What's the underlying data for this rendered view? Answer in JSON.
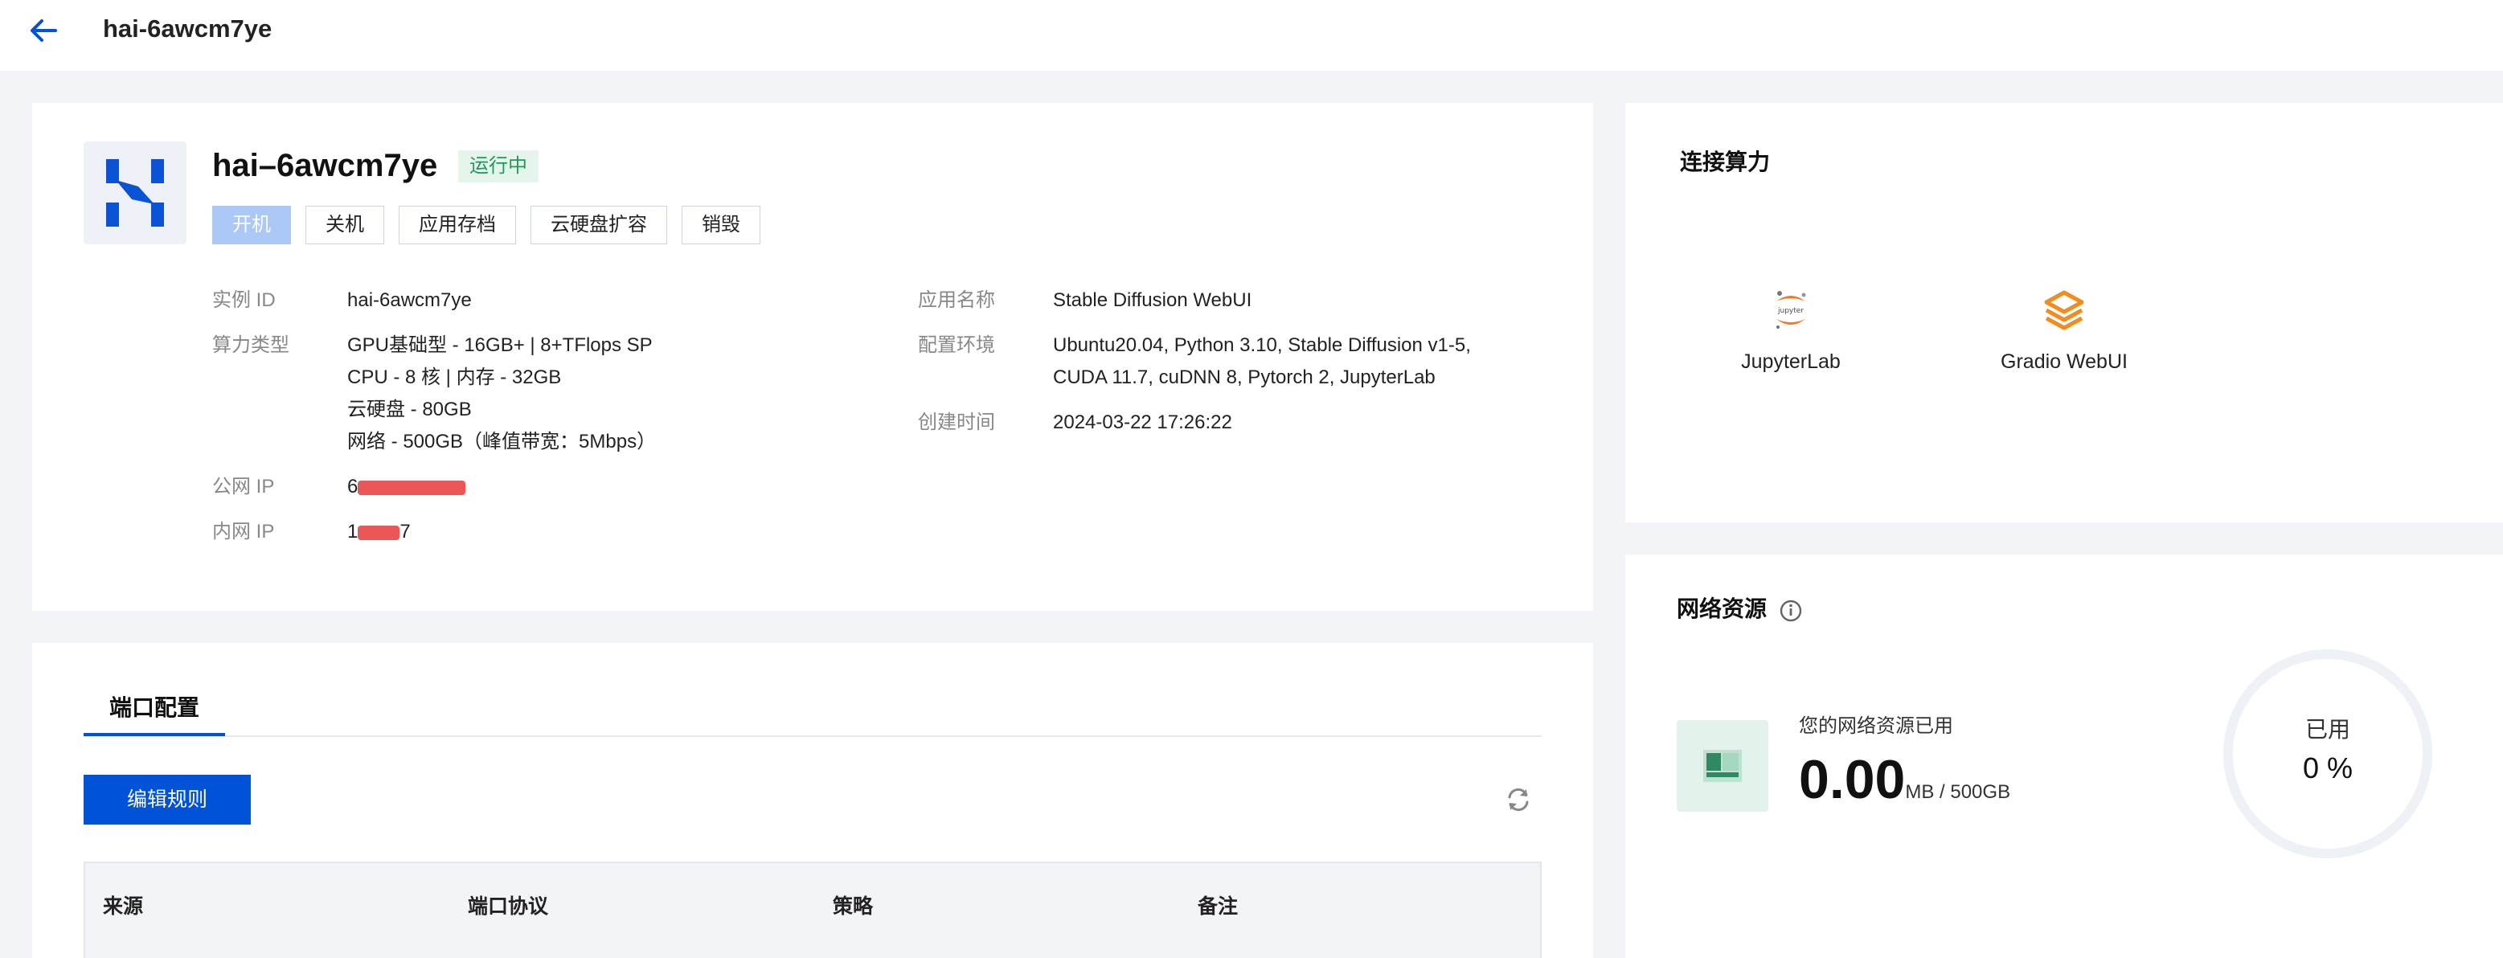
{
  "header": {
    "title": "hai-6awcm7ye"
  },
  "instance": {
    "name": "hai–6awcm7ye",
    "status": "运行中",
    "buttons": [
      "开机",
      "关机",
      "应用存档",
      "云硬盘扩容",
      "销毁"
    ],
    "fields": {
      "instance_id_label": "实例 ID",
      "instance_id": "hai-6awcm7ye",
      "compute_type_label": "算力类型",
      "compute_type_lines": [
        "GPU基础型 - 16GB+ | 8+TFlops SP",
        "CPU - 8 核 | 内存 - 32GB",
        "云硬盘 - 80GB",
        "网络 - 500GB（峰值带宽：5Mbps）"
      ],
      "public_ip_label": "公网 IP",
      "public_ip_visible": "6",
      "private_ip_label": "内网 IP",
      "private_ip_prefix": "1",
      "private_ip_suffix": "7",
      "app_name_label": "应用名称",
      "app_name": "Stable Diffusion WebUI",
      "env_label": "配置环境",
      "env_lines": [
        "Ubuntu20.04, Python 3.10, Stable Diffusion v1-5,",
        "CUDA 11.7, cuDNN 8, Pytorch 2, JupyterLab"
      ],
      "created_label": "创建时间",
      "created": "2024-03-22 17:26:22"
    }
  },
  "connect": {
    "title": "连接算力",
    "apps": [
      {
        "label": "JupyterLab",
        "icon": "jupyter-icon"
      },
      {
        "label": "Gradio WebUI",
        "icon": "gradio-icon"
      }
    ]
  },
  "network": {
    "title": "网络资源",
    "caption": "您的网络资源已用",
    "used": "0.00",
    "unit": "MB / 500GB",
    "ring_label": "已用",
    "ring_value": "0 %",
    "used_percent": 0
  },
  "ports": {
    "tab": "端口配置",
    "edit_button": "编辑规则",
    "columns": [
      "来源",
      "端口协议",
      "策略",
      "备注"
    ]
  },
  "colors": {
    "primary": "#0052d9",
    "status_bg": "#e5f5ec",
    "status_text": "#1e9a5c",
    "jupyter_orange": "#f37726",
    "gradio_orange": "#f28c1e"
  }
}
